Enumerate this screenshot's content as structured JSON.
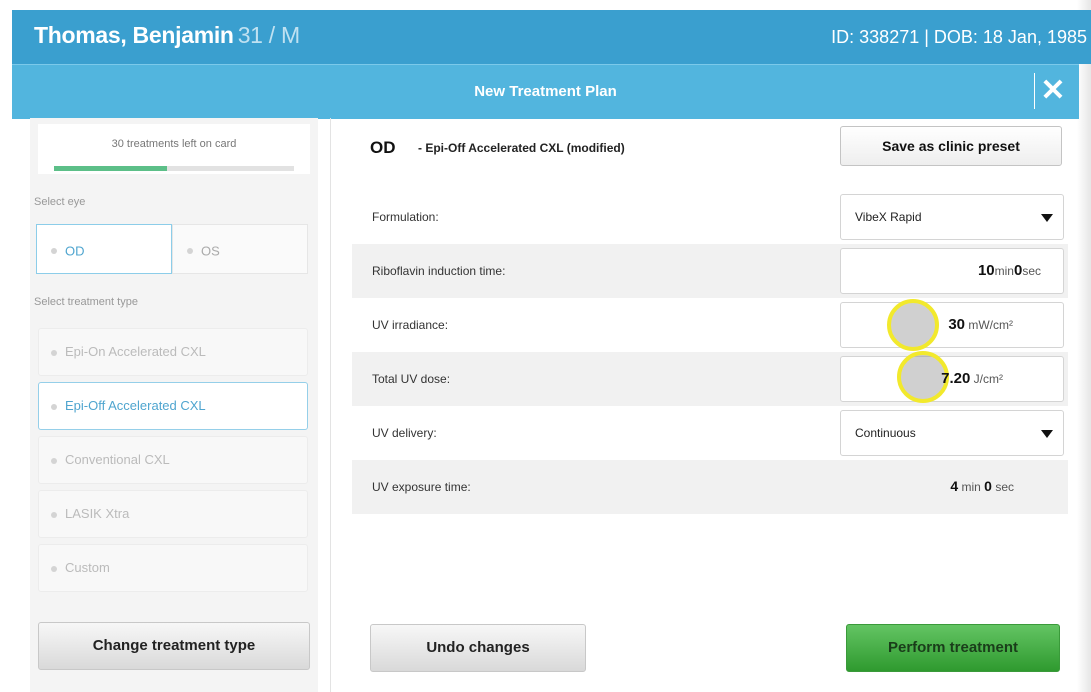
{
  "header": {
    "patient_name": "Thomas, Benjamin",
    "age_sex": "31 / M",
    "id_dob": "ID: 338271 | DOB: 18 Jan, 1985"
  },
  "dialog": {
    "title": "New Treatment Plan",
    "close_icon": "close-icon"
  },
  "card": {
    "treatments_left": "30",
    "treatments_text": "treatments left on card",
    "progress_percent": 47
  },
  "eye": {
    "label": "Select eye",
    "options": [
      "OD",
      "OS"
    ],
    "selected": "OD"
  },
  "treatment_type": {
    "label": "Select treatment type",
    "options": [
      "Epi-On Accelerated CXL",
      "Epi-Off Accelerated CXL",
      "Conventional CXL",
      "LASIK Xtra",
      "Custom"
    ],
    "selected": "Epi-Off Accelerated CXL"
  },
  "plan": {
    "eye": "OD",
    "name": "- Epi-Off Accelerated CXL (modified)",
    "save_preset": "Save as clinic preset"
  },
  "fields": {
    "formulation": {
      "label": "Formulation:",
      "value": "VibeX Rapid"
    },
    "riboflavin": {
      "label": "Riboflavin induction time:",
      "min": "10",
      "min_unit": "min",
      "sec": "0",
      "sec_unit": "sec"
    },
    "irradiance": {
      "label": "UV irradiance:",
      "value": "30",
      "unit": "mW/cm²"
    },
    "dose": {
      "label": "Total UV dose:",
      "value": "7.20",
      "unit": "J/cm²"
    },
    "delivery": {
      "label": "UV delivery:",
      "value": "Continuous"
    },
    "exposure": {
      "label": "UV exposure time:",
      "min": "4",
      "min_unit": "min",
      "sec": "0",
      "sec_unit": "sec"
    }
  },
  "buttons": {
    "change_type": "Change treatment type",
    "undo": "Undo changes",
    "perform": "Perform treatment"
  },
  "colors": {
    "header_blue": "#3a9fcf",
    "subbar_blue": "#52b5de",
    "accent": "#4fa5cf",
    "perform_green": "#2f9a2f",
    "highlight": "#f2e92c"
  }
}
